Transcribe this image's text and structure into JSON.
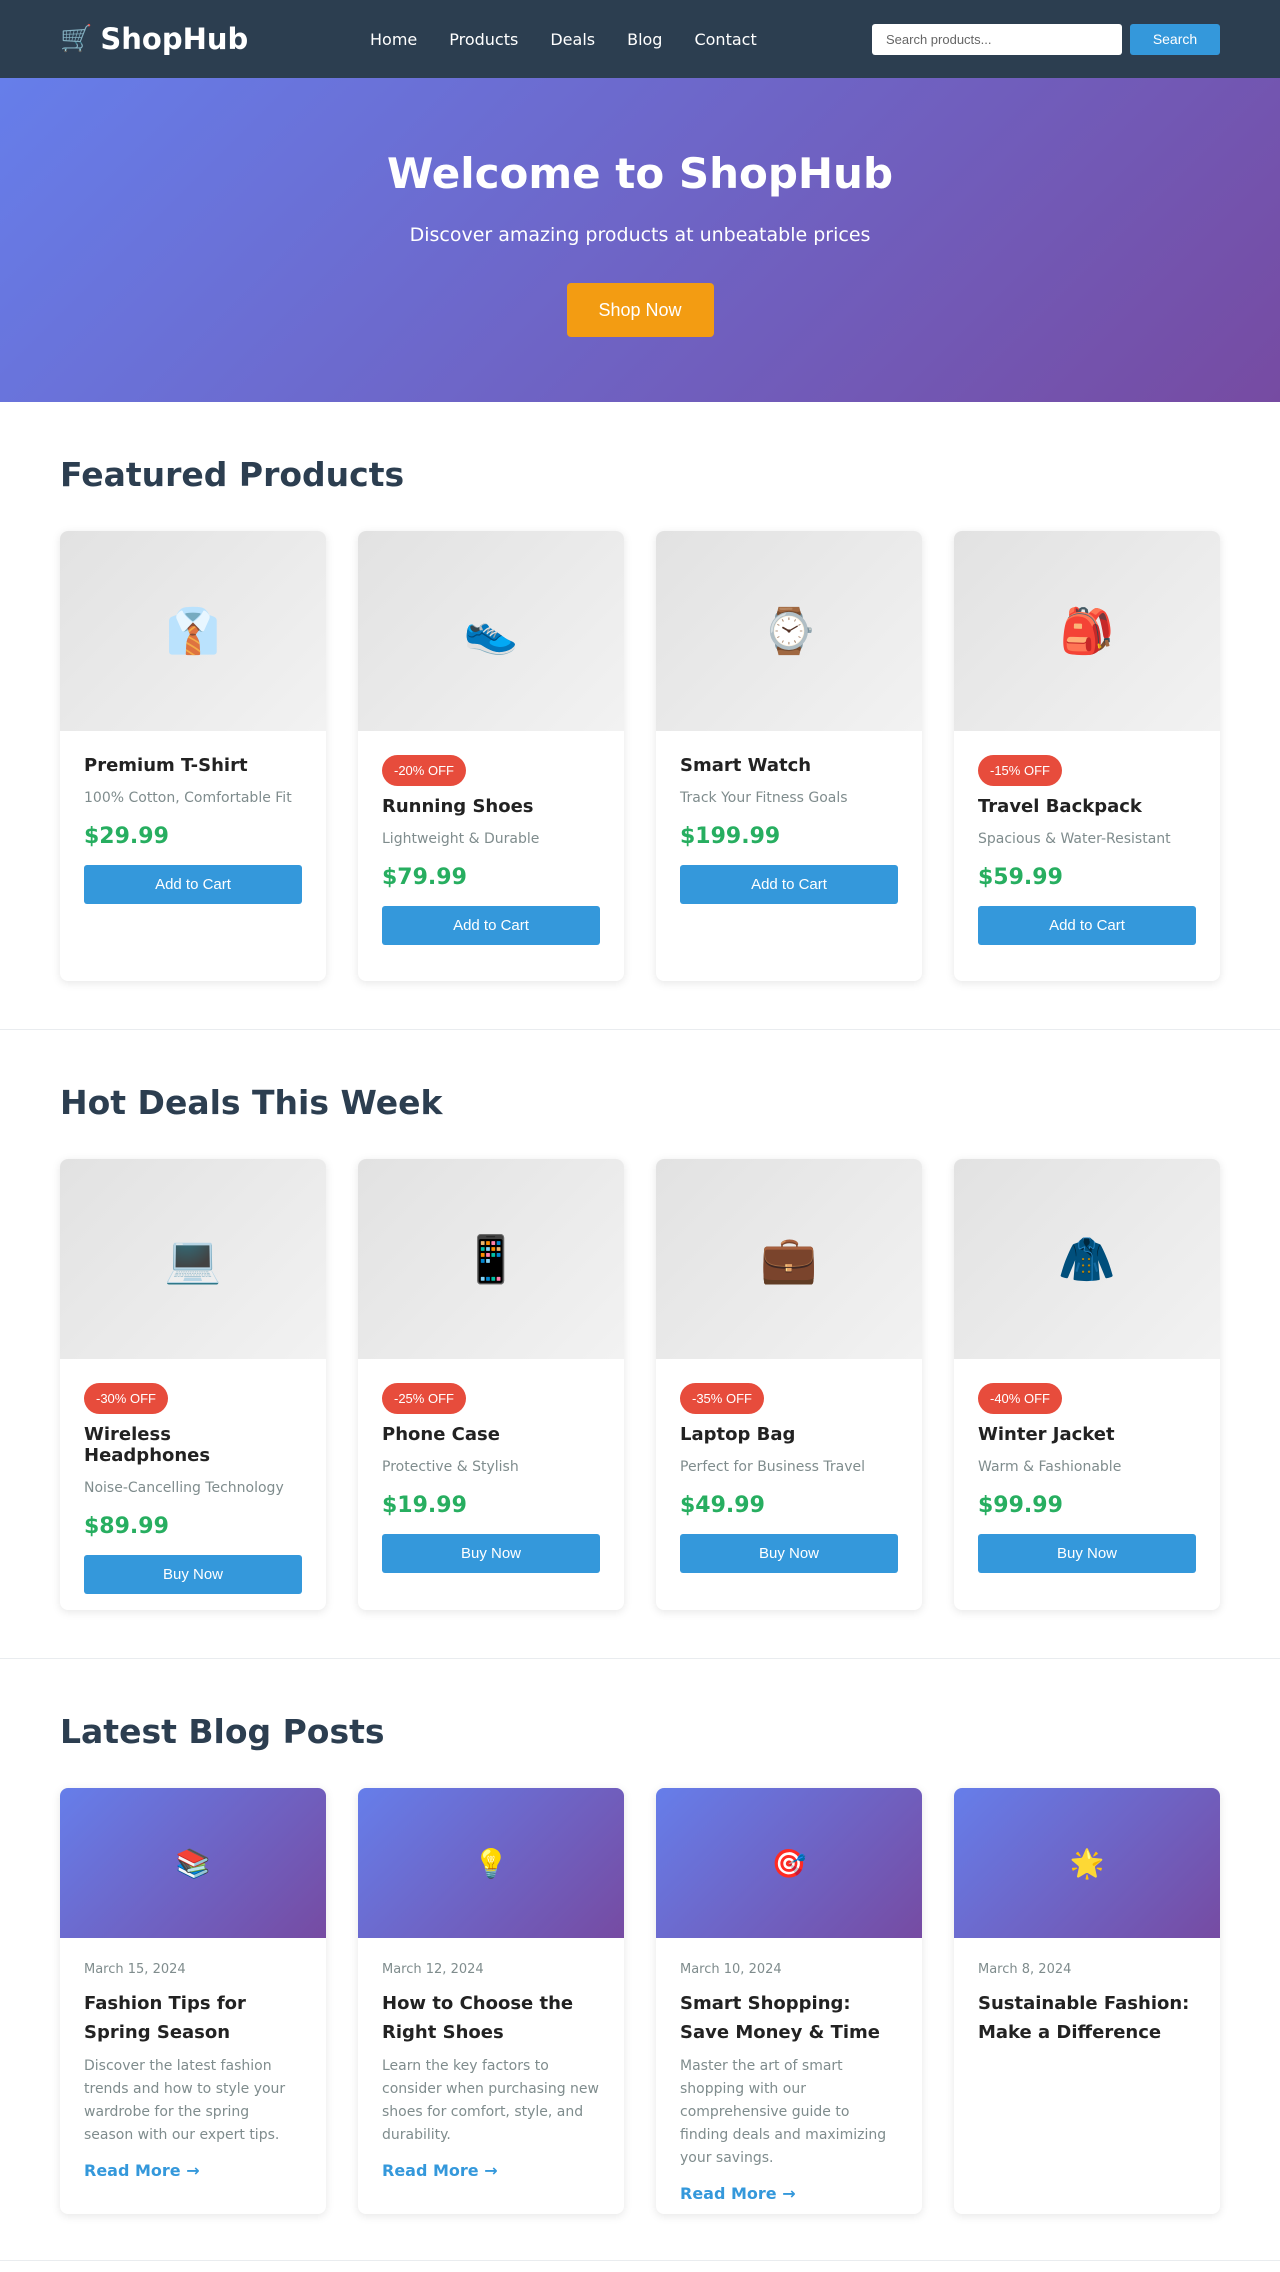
{
  "header": {
    "logo_icon": "shopping-cart-icon",
    "logo_glyph": "🛒",
    "brand": "ShopHub",
    "nav": [
      "Home",
      "Products",
      "Deals",
      "Blog",
      "Contact"
    ],
    "search_placeholder": "Search products...",
    "search_button": "Search"
  },
  "hero": {
    "title": "Welcome to ShopHub",
    "subtitle": "Discover amazing products at unbeatable prices",
    "cta": "Shop Now"
  },
  "featured": {
    "heading": "Featured Products",
    "items": [
      {
        "icon": "shirt-icon",
        "glyph": "👔",
        "badge": "",
        "name": "Premium T-Shirt",
        "desc": "100% Cotton, Comfortable Fit",
        "price": "$29.99",
        "cta": "Add to Cart"
      },
      {
        "icon": "running-shoe-icon",
        "glyph": "👟",
        "badge": "-20% OFF",
        "name": "Running Shoes",
        "desc": "Lightweight & Durable",
        "price": "$79.99",
        "cta": "Add to Cart"
      },
      {
        "icon": "watch-icon",
        "glyph": "⌚",
        "badge": "",
        "name": "Smart Watch",
        "desc": "Track Your Fitness Goals",
        "price": "$199.99",
        "cta": "Add to Cart"
      },
      {
        "icon": "backpack-icon",
        "glyph": "🎒",
        "badge": "-15% OFF",
        "name": "Travel Backpack",
        "desc": "Spacious & Water-Resistant",
        "price": "$59.99",
        "cta": "Add to Cart"
      }
    ]
  },
  "deals": {
    "heading": "Hot Deals This Week",
    "items": [
      {
        "icon": "laptop-icon",
        "glyph": "💻",
        "badge": "-30% OFF",
        "name": "Wireless Headphones",
        "desc": "Noise-Cancelling Technology",
        "price": "$89.99",
        "cta": "Buy Now"
      },
      {
        "icon": "mobile-phone-icon",
        "glyph": "📱",
        "badge": "-25% OFF",
        "name": "Phone Case",
        "desc": "Protective & Stylish",
        "price": "$19.99",
        "cta": "Buy Now"
      },
      {
        "icon": "briefcase-icon",
        "glyph": "💼",
        "badge": "-35% OFF",
        "name": "Laptop Bag",
        "desc": "Perfect for Business Travel",
        "price": "$49.99",
        "cta": "Buy Now"
      },
      {
        "icon": "coat-icon",
        "glyph": "🧥",
        "badge": "-40% OFF",
        "name": "Winter Jacket",
        "desc": "Warm & Fashionable",
        "price": "$99.99",
        "cta": "Buy Now"
      }
    ]
  },
  "blog": {
    "heading": "Latest Blog Posts",
    "posts": [
      {
        "icon": "books-icon",
        "glyph": "📚",
        "date": "March 15, 2024",
        "title": "Fashion Tips for Spring Season",
        "excerpt": "Discover the latest fashion trends and how to style your wardrobe for the spring season with our expert tips.",
        "link": "Read More →"
      },
      {
        "icon": "lightbulb-icon",
        "glyph": "💡",
        "date": "March 12, 2024",
        "title": "How to Choose the Right Shoes",
        "excerpt": "Learn the key factors to consider when purchasing new shoes for comfort, style, and durability.",
        "link": "Read More →"
      },
      {
        "icon": "target-icon",
        "glyph": "🎯",
        "date": "March 10, 2024",
        "title": "Smart Shopping: Save Money & Time",
        "excerpt": "Master the art of smart shopping with our comprehensive guide to finding deals and maximizing your savings.",
        "link": "Read More →"
      },
      {
        "icon": "star-icon",
        "glyph": "🌟",
        "date": "March 8, 2024",
        "title": "Sustainable Fashion: Make a Difference",
        "excerpt": "",
        "link": ""
      }
    ]
  },
  "colors": {
    "header_bg": "#2c3e50",
    "accent_blue": "#3498db",
    "hero_gradient_start": "#667eea",
    "hero_gradient_end": "#764ba2",
    "cta_orange": "#f39c12",
    "price_green": "#27ae60",
    "badge_red": "#e74c3c"
  }
}
